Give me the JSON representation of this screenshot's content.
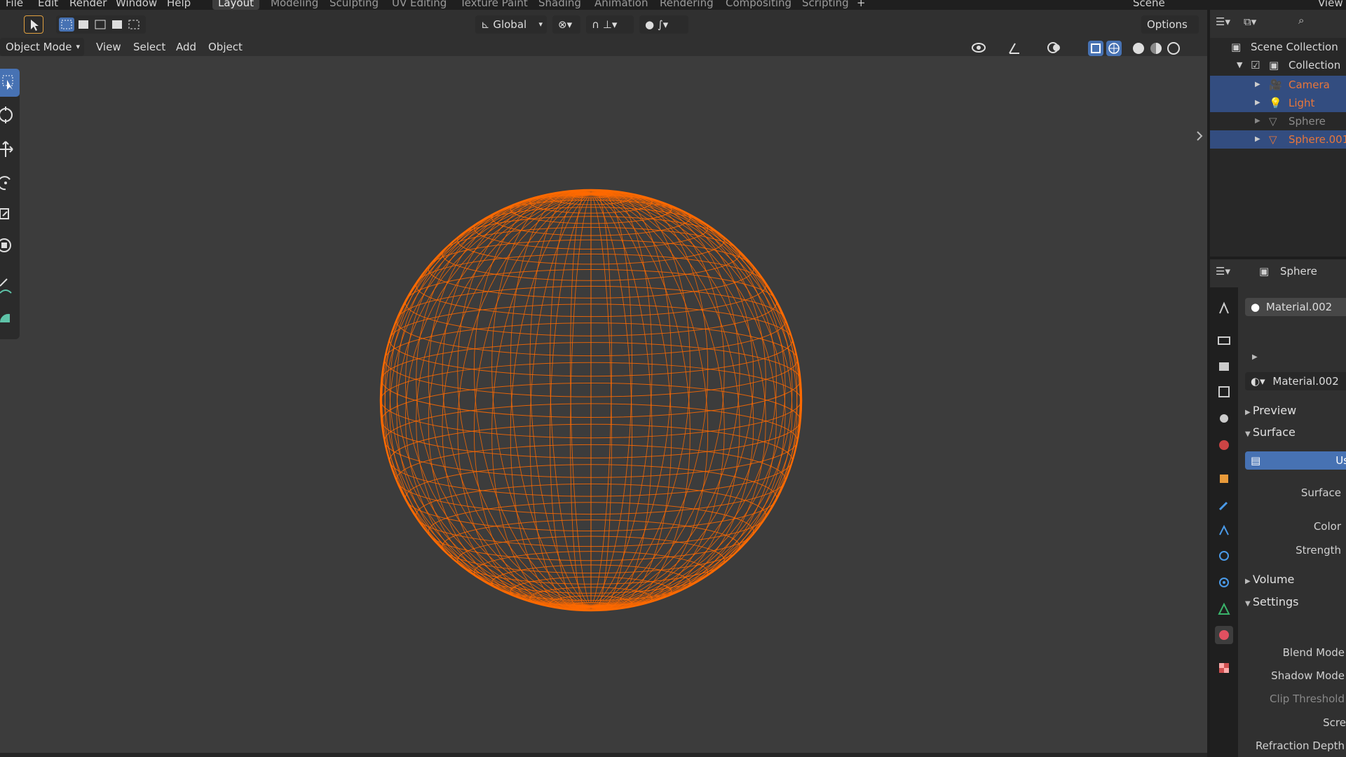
{
  "menu": [
    "File",
    "Edit",
    "Render",
    "Window",
    "Help"
  ],
  "workspaces": [
    "Layout",
    "Modeling",
    "Sculpting",
    "UV Editing",
    "Texture Paint",
    "Shading",
    "Animation",
    "Rendering",
    "Compositing",
    "Scripting"
  ],
  "active_workspace": "Layout",
  "scene_name": "Scene",
  "view_layer_label": "View",
  "tool_header": {
    "transform_orientation": "Global",
    "options_label": "Options"
  },
  "view_header": {
    "mode": "Object Mode",
    "menus": [
      "View",
      "Select",
      "Add",
      "Object"
    ]
  },
  "outliner": {
    "root": "Scene Collection",
    "collection": "Collection",
    "items": [
      {
        "label": "Camera",
        "selected": true,
        "color": "#e8763a"
      },
      {
        "label": "Light",
        "selected": true,
        "color": "#e8763a"
      },
      {
        "label": "Sphere",
        "selected": false,
        "color": "#8a8a8a"
      },
      {
        "label": "Sphere.001",
        "selected": true,
        "color": "#e8763a"
      }
    ]
  },
  "properties": {
    "object_name": "Sphere",
    "material_slot": "Material.002",
    "material_name": "Material.002",
    "panels": {
      "preview": "Preview",
      "surface": "Surface",
      "volume": "Volume",
      "settings": "Settings"
    },
    "use_nodes_label": "Us",
    "fields": {
      "surface": "Surface",
      "color": "Color",
      "strength": "Strength",
      "blend_mode": "Blend Mode",
      "shadow_mode": "Shadow Mode",
      "clip_threshold": "Clip Threshold",
      "screen": "Scre",
      "refraction_depth": "Refraction Depth"
    }
  },
  "colors": {
    "accent_blue": "#4772b3",
    "selection_orange": "#e8763a",
    "wire_orange": "#ff6a00",
    "viewport_bg": "#3c3c3c"
  }
}
